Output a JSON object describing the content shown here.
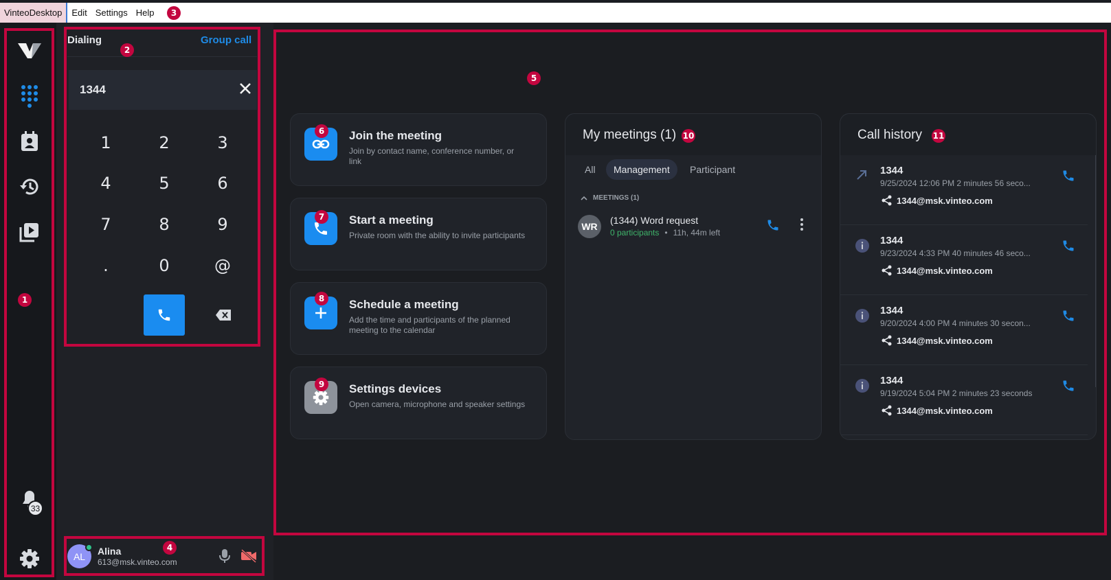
{
  "menu": {
    "items": [
      "VinteoDesktop",
      "Edit",
      "Settings",
      "Help"
    ]
  },
  "rail": {
    "notifications_count": "33",
    "icons": [
      "vinteo-logo-icon",
      "dialpad-icon",
      "contacts-icon",
      "history-icon",
      "recordings-icon",
      "bell-icon",
      "gear-icon"
    ]
  },
  "dialer": {
    "title": "Dialing",
    "group_call": "Group call",
    "number": "1344",
    "keys": [
      "1",
      "2",
      "3",
      "4",
      "5",
      "6",
      "7",
      "8",
      "9",
      ".",
      "0",
      "@"
    ]
  },
  "user": {
    "initials": "AL",
    "name": "Alina",
    "email": "613@msk.vinteo.com"
  },
  "actions": [
    {
      "title": "Join the meeting",
      "desc": "Join by contact name, conference number, or link"
    },
    {
      "title": "Start a meeting",
      "desc": "Private room with the ability to invite participants"
    },
    {
      "title": "Schedule a meeting",
      "desc": "Add the time and participants of the planned meeting to the calendar"
    },
    {
      "title": "Settings devices",
      "desc": "Open camera, microphone and speaker settings"
    }
  ],
  "meetings": {
    "title": "My meetings (1)",
    "tabs": [
      "All",
      "Management",
      "Participant"
    ],
    "active_tab": "Management",
    "section": "MEETINGS (1)",
    "item": {
      "initials": "WR",
      "name": "(1344) Word request",
      "participants": "0 participants",
      "time_left": "11h, 44m left"
    }
  },
  "history": {
    "title": "Call history",
    "items": [
      {
        "number": "1344",
        "meta": "9/25/2024 12:06 PM  2 minutes 56 seco...",
        "address": "1344@msk.vinteo.com",
        "icon": "outgoing-arrow-icon"
      },
      {
        "number": "1344",
        "meta": "9/23/2024 4:33 PM  40 minutes 46 seco...",
        "address": "1344@msk.vinteo.com",
        "icon": "info-icon"
      },
      {
        "number": "1344",
        "meta": "9/20/2024 4:00 PM  4 minutes 30 secon...",
        "address": "1344@msk.vinteo.com",
        "icon": "info-icon"
      },
      {
        "number": "1344",
        "meta": "9/19/2024 5:04 PM  2 minutes 23 seconds",
        "address": "1344@msk.vinteo.com",
        "icon": "info-icon"
      }
    ]
  },
  "annotations": [
    "1",
    "2",
    "3",
    "4",
    "5",
    "6",
    "7",
    "8",
    "9",
    "10",
    "11"
  ],
  "colors": {
    "accent": "#1a8cf0",
    "annotation": "#c3063f",
    "participants_green": "#3fb46a"
  }
}
